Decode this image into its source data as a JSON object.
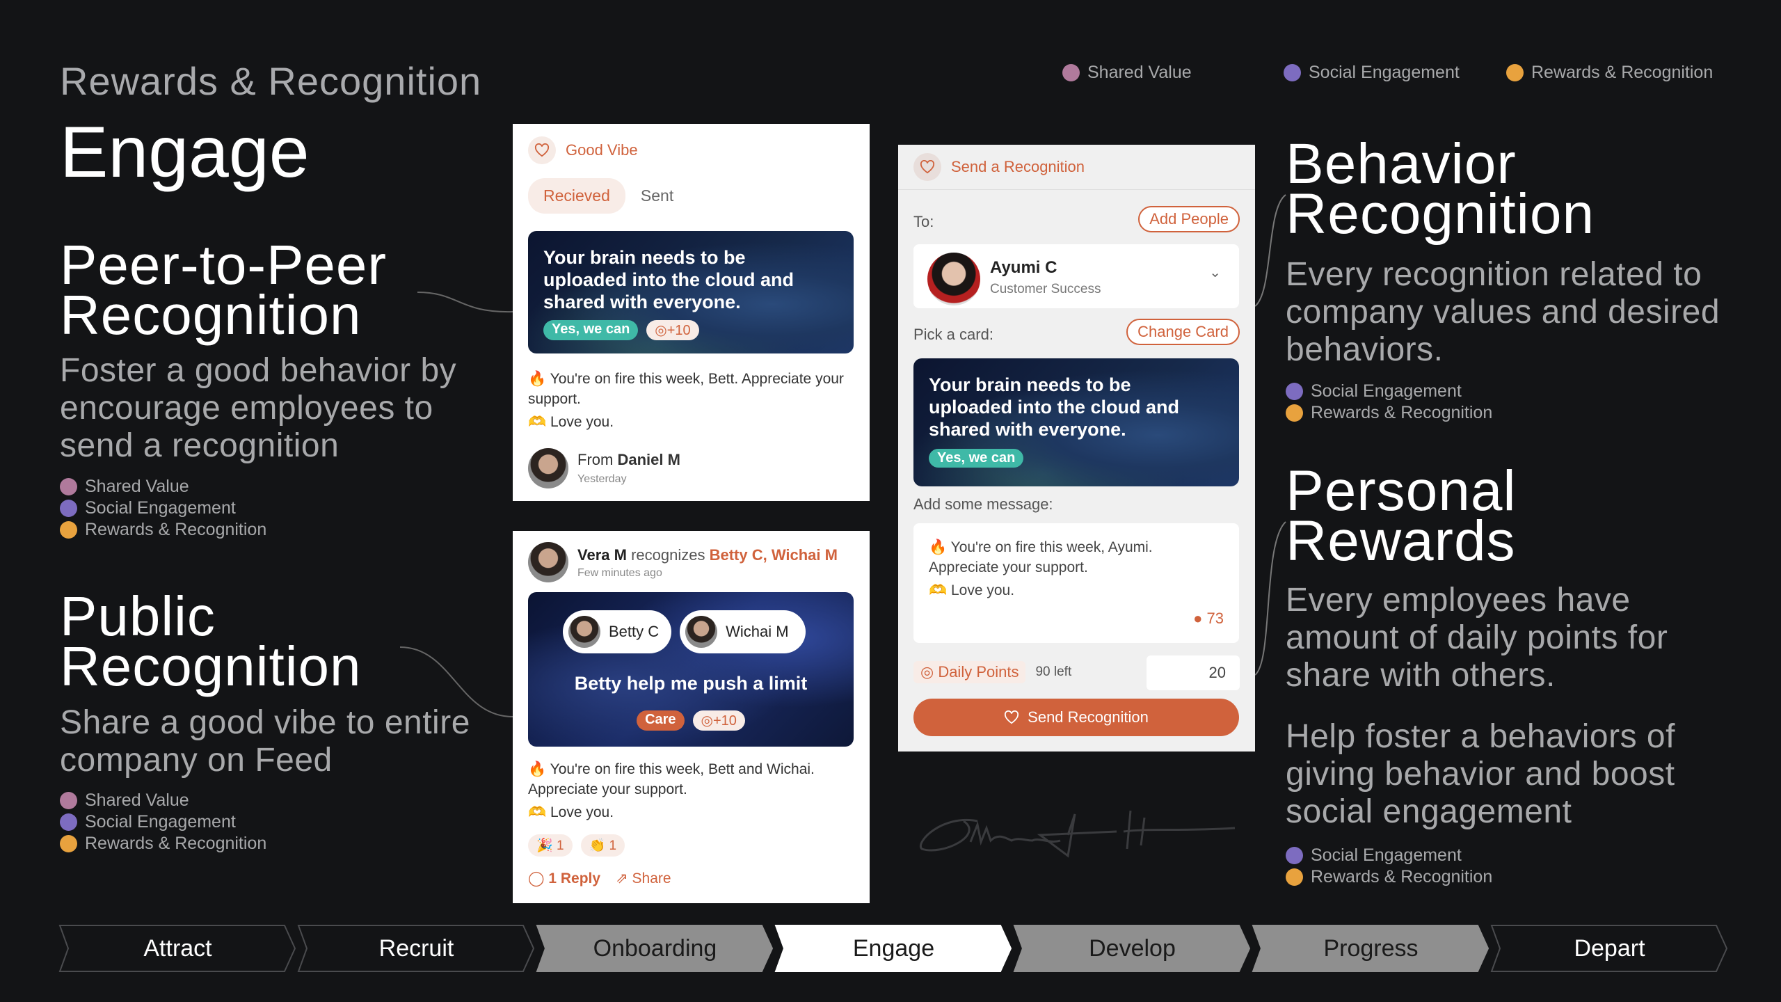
{
  "colors": {
    "shared_value": "#b07a9c",
    "social_engagement": "#7d6cc0",
    "rewards_recognition": "#e8a23e",
    "accent": "#d0623c",
    "teal": "#3fb9a7"
  },
  "kicker": "Rewards & Recognition",
  "hero": "Engage",
  "top_legend": [
    "Shared Value",
    "Social Engagement",
    "Rewards & Recognition"
  ],
  "peer": {
    "title_1": "Peer-to-Peer",
    "title_2": "Recognition",
    "desc": "Foster a good behavior by encourage employees to send a recognition",
    "legend": [
      "Shared Value",
      "Social Engagement",
      "Rewards & Recognition"
    ]
  },
  "public": {
    "title_1": "Public",
    "title_2": "Recognition",
    "desc": "Share a good vibe to entire company on Feed",
    "legend": [
      "Shared Value",
      "Social Engagement",
      "Rewards & Recognition"
    ]
  },
  "behavior": {
    "title_1": "Behavior",
    "title_2": "Recognition",
    "desc": "Every recognition related to company values and desired behaviors.",
    "legend": [
      "Social Engagement",
      "Rewards & Recognition"
    ]
  },
  "personal": {
    "title_1": "Personal",
    "title_2": "Rewards",
    "desc": "Every employees have amount of daily points for share with others.",
    "desc2": "Help foster a behaviors of giving behavior and boost social engagement",
    "legend": [
      "Social Engagement",
      "Rewards & Recognition"
    ]
  },
  "good_vibe": {
    "title": "Good Vibe",
    "tabs": [
      "Recieved",
      "Sent"
    ],
    "active_tab": "Recieved",
    "card_text": "Your brain needs to be uploaded into the cloud and shared with everyone.",
    "tag": "Yes, we can",
    "points": "+10",
    "msg1": "You're on fire this week, Bett. Appreciate your support.",
    "msg2": "Love you.",
    "from_label": "From",
    "from_name": "Daniel M",
    "time": "Yesterday"
  },
  "feed": {
    "sender": "Vera M",
    "verb": "recognizes",
    "recipients": "Betty C, Wichai M",
    "time": "Few minutes ago",
    "people": [
      "Betty C",
      "Wichai M"
    ],
    "card_text": "Betty help me push a limit",
    "tag": "Care",
    "points": "+10",
    "msg1": "You're on fire this week, Bett and Wichai. Appreciate your support.",
    "msg2": "Love you.",
    "reactions": [
      {
        "icon": "party-popper",
        "count": "1"
      },
      {
        "icon": "clapping-hands",
        "count": "1"
      }
    ],
    "reply": "1 Reply",
    "share": "Share"
  },
  "send": {
    "title": "Send a Recognition",
    "to_label": "To:",
    "add_people": "Add People",
    "recipient_name": "Ayumi C",
    "recipient_dept": "Customer Success",
    "pick_label": "Pick a card:",
    "change_card": "Change Card",
    "card_text": "Your brain needs to be uploaded into the cloud and shared with everyone.",
    "tag": "Yes, we can",
    "message_label": "Add some message:",
    "msg1": "You're on fire this week, Ayumi. Appreciate your support.",
    "msg2": "Love you.",
    "char_count": "73",
    "daily_points_label": "Daily Points",
    "points_left": "90 left",
    "points_value": "20",
    "submit": "Send Recognition"
  },
  "signature": "Sittiporng Hana",
  "stages": [
    {
      "label": "Attract",
      "state": "outline"
    },
    {
      "label": "Recruit",
      "state": "outline"
    },
    {
      "label": "Onboarding",
      "state": "gray"
    },
    {
      "label": "Engage",
      "state": "active"
    },
    {
      "label": "Develop",
      "state": "gray"
    },
    {
      "label": "Progress",
      "state": "gray"
    },
    {
      "label": "Depart",
      "state": "outline"
    }
  ]
}
